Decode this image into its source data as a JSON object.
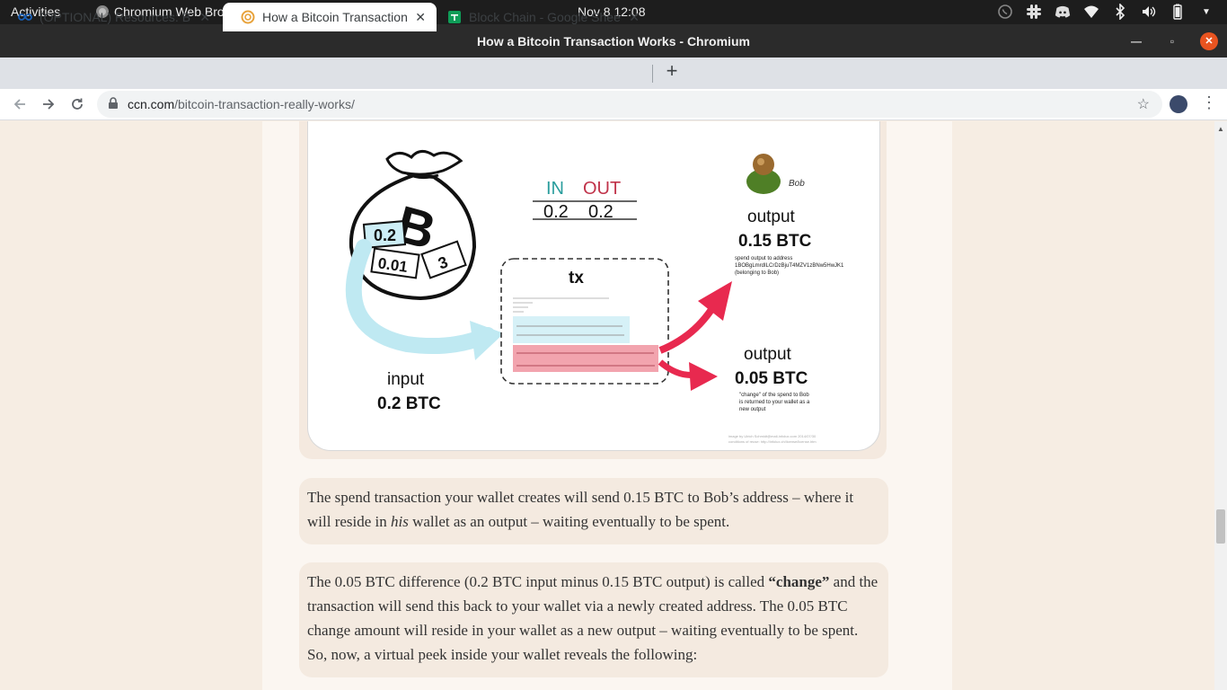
{
  "system": {
    "activities": "Activities",
    "app_name": "Chromium Web Browser",
    "clock": "Nov 8  12:08"
  },
  "window": {
    "title": "How a Bitcoin Transaction Works - Chromium"
  },
  "tabs": [
    {
      "label": "(OPTIONAL) Resources: B",
      "icon": "infinity-icon"
    },
    {
      "label": "How a Bitcoin Transaction",
      "icon": "ccn-icon"
    },
    {
      "label": "Block Chain - Google Shee",
      "icon": "sheets-icon"
    }
  ],
  "toolbar": {
    "url_domain": "ccn.com",
    "url_path": "/bitcoin-transaction-really-works/"
  },
  "figure": {
    "bag_note_1": "0.2",
    "bag_note_2": "0.01",
    "bag_note_3": "3",
    "in_label": "IN",
    "out_label": "OUT",
    "in_value": "0.2",
    "out_value": "0.2",
    "tx_label": "tx",
    "bob_name": "Bob",
    "output1_title": "output",
    "output1_value": "0.15 BTC",
    "output1_desc_1": "spend output to address",
    "output1_desc_2": "1BOBgLmrdILCrDzBjuT4MZV1zBNw5HwJK1",
    "output1_desc_3": "(belonging to Bob)",
    "output2_title": "output",
    "output2_value": "0.05 BTC",
    "output2_desc_1": "\"change\" of the spend to Bob",
    "output2_desc_2": "is returned to your wallet as a",
    "output2_desc_3": "new output",
    "input_title": "input",
    "input_value": "0.2 BTC",
    "credit_1": "image by Ulrich Schmidt@mail-infolux.com 2014/07/30",
    "credit_2": "conditions of reuse: http://infolux.ch/license/license.htm",
    "colors": {
      "in": "#2a9d9d",
      "out": "#c0334a",
      "arrow_red": "#e8294f",
      "arrow_blue": "#bfe9f2",
      "highlight_red": "#f2a4ae",
      "highlight_blue": "#d6f1f7"
    }
  },
  "paragraphs": {
    "p1_a": "The spend transaction your wallet creates will send 0.15 BTC to Bob’s address – where it will reside in ",
    "p1_em": "his",
    "p1_b": " wallet as an output – waiting eventually to be spent.",
    "p2_a": "The 0.05 BTC difference (0.2 BTC input minus 0.15 BTC output) is called ",
    "p2_bold": "“change”",
    "p2_b": " and the transaction will send this back to your wallet via a newly created address. The 0.05 BTC change amount will reside in your wallet as a new output – waiting eventually to be spent. So, now, a virtual peek inside your wallet reveals the following:"
  }
}
